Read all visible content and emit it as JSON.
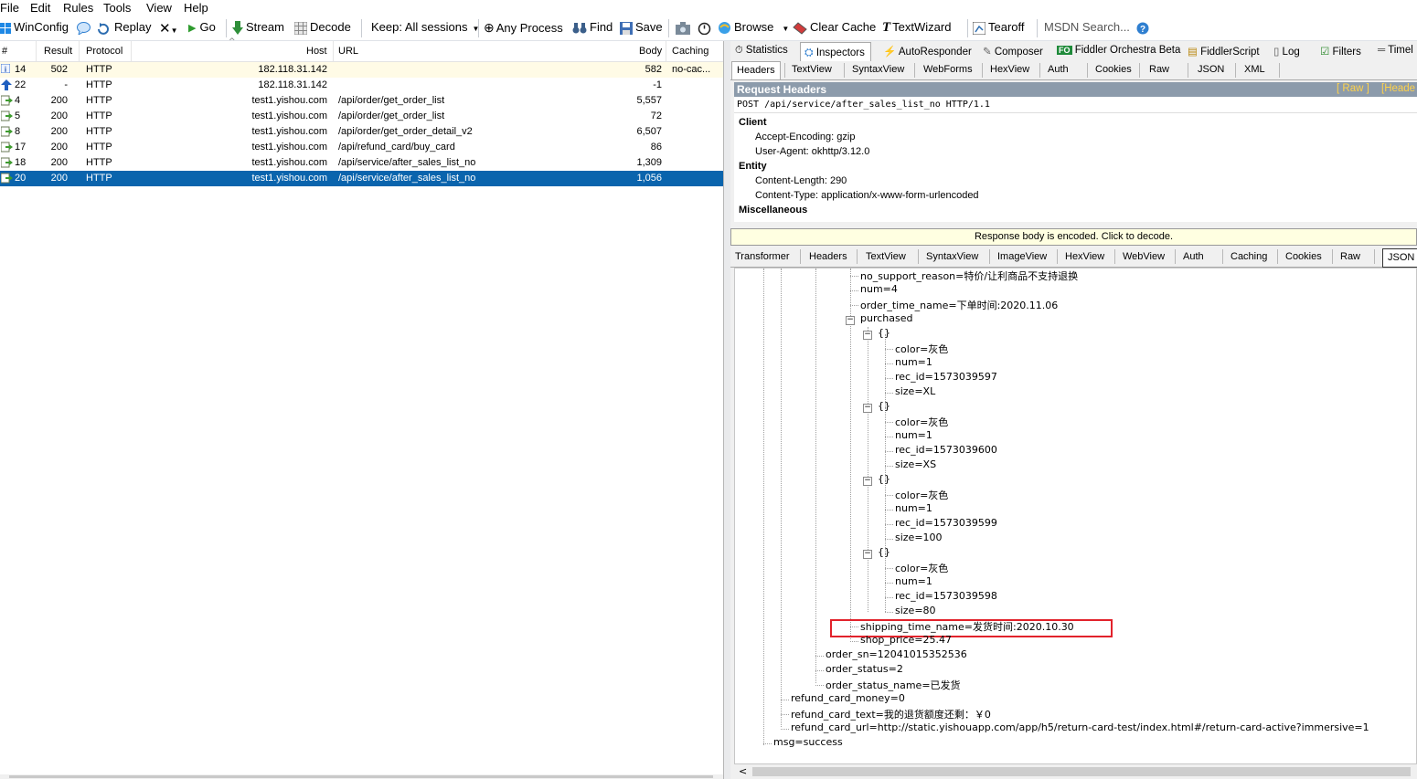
{
  "menu": [
    "File",
    "Edit",
    "Rules",
    "Tools",
    "View",
    "Help"
  ],
  "toolbar": {
    "winconfig": "WinConfig",
    "replay": "Replay",
    "go": "Go",
    "stream": "Stream",
    "decode": "Decode",
    "keep": "Keep: All sessions",
    "any_process": "Any Process",
    "find": "Find",
    "save": "Save",
    "browse": "Browse",
    "clear_cache": "Clear Cache",
    "textwizard": "TextWizard",
    "tearoff": "Tearoff",
    "msdn_placeholder": "MSDN Search..."
  },
  "columns": [
    "#",
    "Result",
    "Protocol",
    "Host",
    "URL",
    "Body",
    "Caching"
  ],
  "sessions": [
    {
      "id": "14",
      "result": "502",
      "protocol": "HTTP",
      "host": "182.118.31.142",
      "url": "",
      "body": "582",
      "caching": "no-cac...",
      "icon": "info",
      "highlight": true,
      "selected": false
    },
    {
      "id": "22",
      "result": "-",
      "protocol": "HTTP",
      "host": "182.118.31.142",
      "url": "",
      "body": "-1",
      "caching": "",
      "icon": "upload",
      "highlight": false,
      "selected": false
    },
    {
      "id": "4",
      "result": "200",
      "protocol": "HTTP",
      "host": "test1.yishou.com",
      "url": "/api/order/get_order_list",
      "body": "5,557",
      "caching": "",
      "icon": "doc",
      "highlight": false,
      "selected": false
    },
    {
      "id": "5",
      "result": "200",
      "protocol": "HTTP",
      "host": "test1.yishou.com",
      "url": "/api/order/get_order_list",
      "body": "72",
      "caching": "",
      "icon": "doc",
      "highlight": false,
      "selected": false
    },
    {
      "id": "8",
      "result": "200",
      "protocol": "HTTP",
      "host": "test1.yishou.com",
      "url": "/api/order/get_order_detail_v2",
      "body": "6,507",
      "caching": "",
      "icon": "doc",
      "highlight": false,
      "selected": false
    },
    {
      "id": "17",
      "result": "200",
      "protocol": "HTTP",
      "host": "test1.yishou.com",
      "url": "/api/refund_card/buy_card",
      "body": "86",
      "caching": "",
      "icon": "doc",
      "highlight": false,
      "selected": false
    },
    {
      "id": "18",
      "result": "200",
      "protocol": "HTTP",
      "host": "test1.yishou.com",
      "url": "/api/service/after_sales_list_no",
      "body": "1,309",
      "caching": "",
      "icon": "doc",
      "highlight": false,
      "selected": false
    },
    {
      "id": "20",
      "result": "200",
      "protocol": "HTTP",
      "host": "test1.yishou.com",
      "url": "/api/service/after_sales_list_no",
      "body": "1,056",
      "caching": "",
      "icon": "doc",
      "highlight": false,
      "selected": true
    }
  ],
  "top_tabs": [
    "Statistics",
    "Inspectors",
    "AutoResponder",
    "Composer",
    "Fiddler Orchestra Beta",
    "FiddlerScript",
    "Log",
    "Filters",
    "Timel"
  ],
  "request_tabs": [
    "Headers",
    "TextView",
    "SyntaxView",
    "WebForms",
    "HexView",
    "Auth",
    "Cookies",
    "Raw",
    "JSON",
    "XML"
  ],
  "request_headers": {
    "title": "Request Headers",
    "raw_link": "[ Raw ]",
    "header_link": "[Heade",
    "request_line": "POST /api/service/after_sales_list_no HTTP/1.1",
    "client_label": "Client",
    "accept_encoding": "Accept-Encoding: gzip",
    "user_agent": "User-Agent: okhttp/3.12.0",
    "entity_label": "Entity",
    "content_length": "Content-Length: 290",
    "content_type": "Content-Type: application/x-www-form-urlencoded",
    "misc_label": "Miscellaneous"
  },
  "decode_bar": "Response body is encoded. Click to decode.",
  "response_tabs": [
    "Transformer",
    "Headers",
    "TextView",
    "SyntaxView",
    "ImageView",
    "HexView",
    "WebView",
    "Auth",
    "Caching",
    "Cookies",
    "Raw",
    "JSON"
  ],
  "tree": {
    "no_support_reason": "no_support_reason=特价/让利商品不支持退换",
    "num": "num=4",
    "order_time_name": "order_time_name=下单时间:2020.11.06",
    "purchased": "purchased",
    "items": [
      {
        "brace": "{}",
        "color": "color=灰色",
        "num": "num=1",
        "rec_id": "rec_id=1573039597",
        "size": "size=XL"
      },
      {
        "brace": "{}",
        "color": "color=灰色",
        "num": "num=1",
        "rec_id": "rec_id=1573039600",
        "size": "size=XS"
      },
      {
        "brace": "{}",
        "color": "color=灰色",
        "num": "num=1",
        "rec_id": "rec_id=1573039599",
        "size": "size=100"
      },
      {
        "brace": "{}",
        "color": "color=灰色",
        "num": "num=1",
        "rec_id": "rec_id=1573039598",
        "size": "size=80"
      }
    ],
    "shipping_time_name": "shipping_time_name=发货时间:2020.10.30",
    "shop_price": "shop_price=25.47",
    "order_sn": "order_sn=12041015352536",
    "order_status": "order_status=2",
    "order_status_name": "order_status_name=已发货",
    "refund_card_money": "refund_card_money=0",
    "refund_card_text": "refund_card_text=我的退货额度还剩：￥0",
    "refund_card_url": "refund_card_url=http://static.yishouapp.com/app/h5/return-card-test/index.html#/return-card-active?immersive=1",
    "msg": "msg=success"
  },
  "colors": {
    "selection": "#0a64ad",
    "highlight_row": "#fffbe6",
    "header_bar": "#8c9bab",
    "annotation": "#e2222b"
  }
}
